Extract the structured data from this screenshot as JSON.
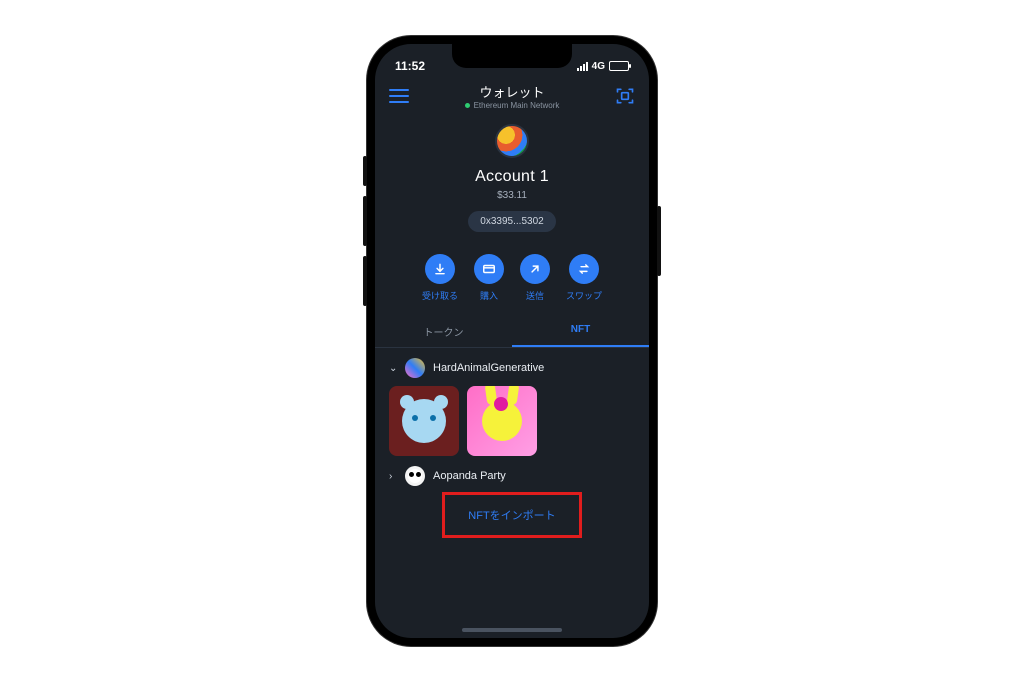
{
  "status": {
    "time": "11:52",
    "network_type": "4G"
  },
  "nav": {
    "title": "ウォレット",
    "network": "Ethereum Main Network"
  },
  "account": {
    "name": "Account 1",
    "balance": "$33.11",
    "address_short": "0x3395...5302"
  },
  "actions": {
    "receive": {
      "label": "受け取る"
    },
    "buy": {
      "label": "購入"
    },
    "send": {
      "label": "送信"
    },
    "swap": {
      "label": "スワップ"
    }
  },
  "tabs": {
    "tokens": "トークン",
    "nft": "NFT"
  },
  "collections": [
    {
      "name": "HardAnimalGenerative",
      "expanded": true
    },
    {
      "name": "Aopanda Party",
      "expanded": false
    }
  ],
  "import": {
    "link": "NFTをインポート"
  },
  "colors": {
    "primary": "#2f7df6",
    "bg": "#1b2027",
    "highlight": "#e11d1d"
  }
}
